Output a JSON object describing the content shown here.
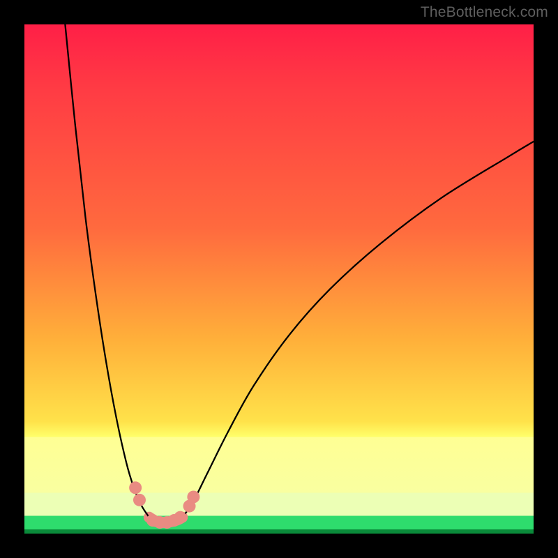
{
  "watermark": "TheBottleneck.com",
  "chart_data": {
    "type": "line",
    "title": "",
    "xlabel": "",
    "ylabel": "",
    "xlim": [
      0,
      100
    ],
    "ylim": [
      0,
      100
    ],
    "series": [
      {
        "name": "left-branch",
        "x": [
          8,
          10,
          12,
          14,
          16,
          18,
          20,
          21.5,
          23,
          24.5
        ],
        "values": [
          100,
          80,
          62,
          47,
          34,
          23,
          14,
          9,
          5.5,
          3.2
        ]
      },
      {
        "name": "right-branch",
        "x": [
          31,
          33,
          36,
          40,
          45,
          52,
          60,
          70,
          82,
          95,
          100
        ],
        "values": [
          3.2,
          6,
          12,
          20,
          29,
          39,
          48,
          57,
          66,
          74,
          77
        ]
      }
    ],
    "valley": {
      "name": "valley-band",
      "x": [
        24.5,
        25.8,
        27.2,
        28.5,
        30,
        31
      ],
      "values": [
        3.2,
        2.4,
        2.2,
        2.3,
        2.7,
        3.2
      ]
    },
    "markers": {
      "name": "valley-dots",
      "color": "#e98b82",
      "points": [
        {
          "x": 21.8,
          "y": 9.0
        },
        {
          "x": 22.6,
          "y": 6.6
        },
        {
          "x": 25.2,
          "y": 2.6
        },
        {
          "x": 26.6,
          "y": 2.2
        },
        {
          "x": 28.0,
          "y": 2.2
        },
        {
          "x": 29.4,
          "y": 2.6
        },
        {
          "x": 30.6,
          "y": 3.2
        },
        {
          "x": 32.4,
          "y": 5.4
        },
        {
          "x": 33.2,
          "y": 7.2
        }
      ]
    },
    "gradient_bands": [
      {
        "name": "red-orange-yellow",
        "from_pct": 0,
        "to_pct": 81,
        "color_top": "#ff1f47",
        "color_bot": "#ffff6a"
      },
      {
        "name": "light-yellow",
        "from_pct": 81,
        "to_pct": 92,
        "color_top": "#ffff94",
        "color_bot": "#f9ffa0"
      },
      {
        "name": "pale-green",
        "from_pct": 92,
        "to_pct": 96.5,
        "color_top": "#ecffb5",
        "color_bot": "#ecffb5"
      },
      {
        "name": "bright-green",
        "from_pct": 96.5,
        "to_pct": 99.2,
        "color_top": "#2edc6d",
        "color_bot": "#2edc6d"
      },
      {
        "name": "dark-green",
        "from_pct": 99.2,
        "to_pct": 100,
        "color_top": "#0a8a3a",
        "color_bot": "#0a8a3a"
      }
    ]
  }
}
